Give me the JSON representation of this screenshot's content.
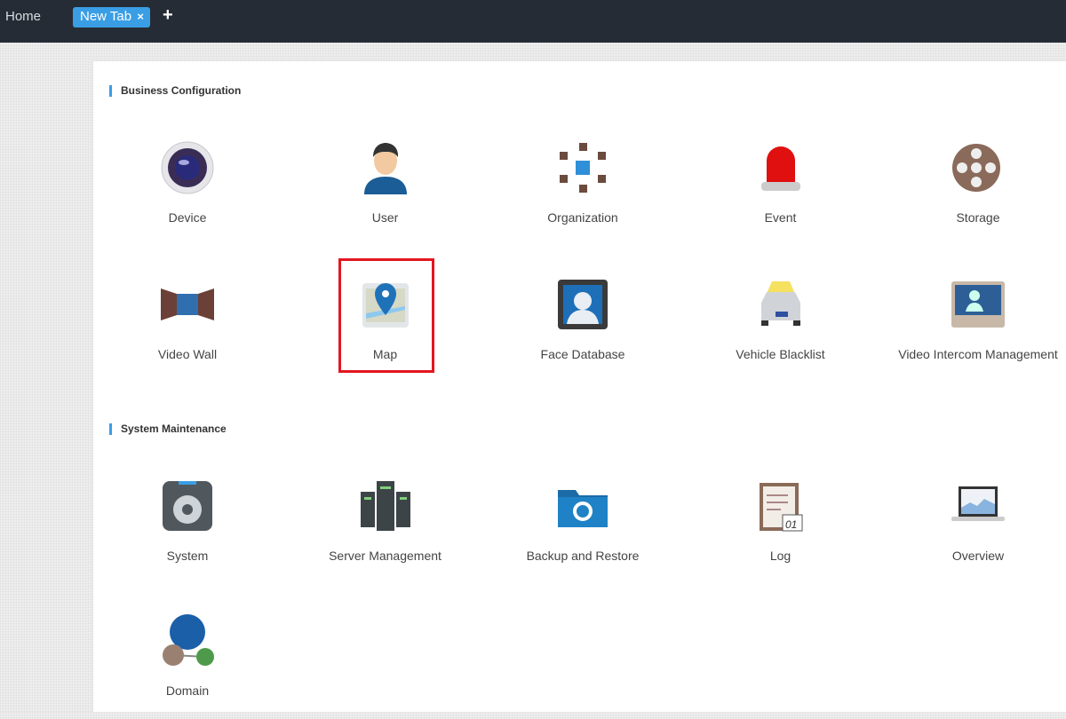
{
  "topbar": {
    "home": "Home",
    "tab": "New Tab",
    "close": "×",
    "add": "+"
  },
  "sections": [
    {
      "title": "Business Configuration",
      "items": [
        {
          "label": "Device",
          "icon": "camera-lens-icon"
        },
        {
          "label": "User",
          "icon": "user-icon"
        },
        {
          "label": "Organization",
          "icon": "organization-cubes-icon"
        },
        {
          "label": "Event",
          "icon": "alarm-siren-icon"
        },
        {
          "label": "Storage",
          "icon": "film-reel-icon"
        },
        {
          "label": "Video Wall",
          "icon": "video-wall-icon"
        },
        {
          "label": "Map",
          "icon": "map-pin-icon"
        },
        {
          "label": "Face Database",
          "icon": "face-database-icon"
        },
        {
          "label": "Vehicle Blacklist",
          "icon": "car-icon"
        },
        {
          "label": "Video Intercom Management",
          "icon": "intercom-icon"
        }
      ]
    },
    {
      "title": "System Maintenance",
      "items": [
        {
          "label": "System",
          "icon": "gear-icon"
        },
        {
          "label": "Server Management",
          "icon": "server-icon"
        },
        {
          "label": "Backup and Restore",
          "icon": "folder-restore-icon"
        },
        {
          "label": "Log",
          "icon": "log-notepad-icon"
        },
        {
          "label": "Overview",
          "icon": "laptop-chart-icon"
        },
        {
          "label": "Domain",
          "icon": "domain-network-icon"
        }
      ]
    }
  ],
  "colors": {
    "accent": "#3a9ee4",
    "topbar": "#262c35",
    "highlight": "#e3161f"
  }
}
